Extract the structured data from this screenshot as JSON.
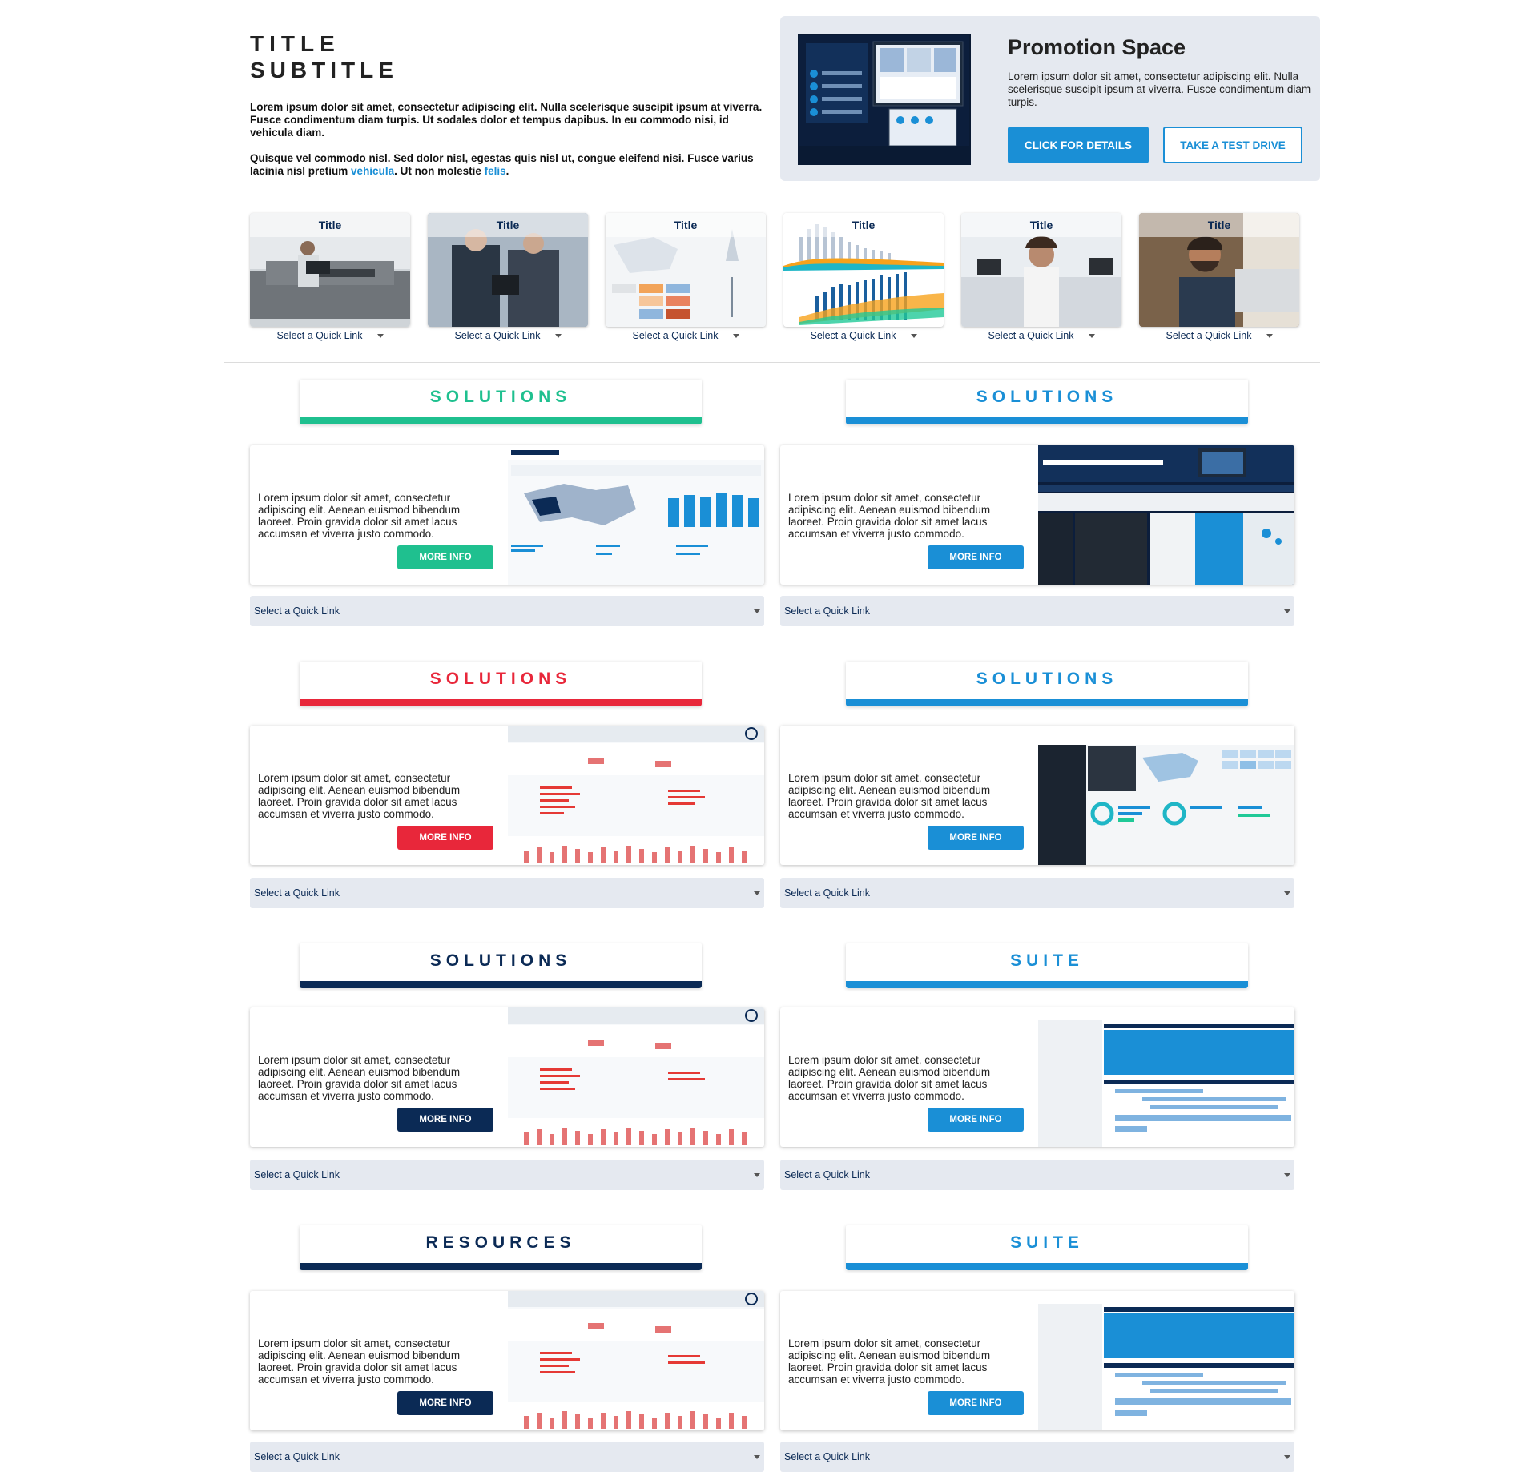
{
  "intro": {
    "title": "TITLE",
    "subtitle": "SUBTITLE",
    "para1": "Lorem ipsum dolor sit amet, consectetur adipiscing elit. Nulla scelerisque suscipit ipsum at viverra. Fusce condimentum diam turpis. Ut sodales dolor et tempus dapibus. In eu commodo nisi, id vehicula diam.",
    "para2_a": "Quisque vel commodo nisl. Sed dolor nisl, egestas quis nisl ut, congue eleifend nisi. Fusce varius lacinia nisl pretium ",
    "link1": "vehicula",
    "para2_b": ". Ut non molestie ",
    "link2": "felis",
    "para2_c": "."
  },
  "promo": {
    "title": "Promotion Space",
    "text": "Lorem ipsum dolor sit amet, consectetur adipiscing elit. Nulla scelerisque suscipit ipsum at viverra. Fusce condimentum diam turpis.",
    "primary_label": "CLICK FOR DETAILS",
    "secondary_label": "TAKE A TEST DRIVE"
  },
  "tiles": [
    {
      "title": "Title",
      "select": "Select a Quick Link"
    },
    {
      "title": "Title",
      "select": "Select a Quick Link"
    },
    {
      "title": "Title",
      "select": "Select a Quick Link"
    },
    {
      "title": "Title",
      "select": "Select a Quick Link"
    },
    {
      "title": "Title",
      "select": "Select a Quick Link"
    },
    {
      "title": "Title",
      "select": "Select a Quick Link"
    }
  ],
  "sections": [
    {
      "heading": "SOLUTIONS",
      "accent": "#1fc08f",
      "text": "Lorem ipsum dolor sit amet, consectetur adipiscing elit. Aenean euismod bibendum laoreet. Proin gravida dolor sit amet lacus accumsan et viverra justo commodo.",
      "button": "MORE INFO",
      "select": "Select a Quick Link"
    },
    {
      "heading": "SOLUTIONS",
      "accent": "#1a8fd6",
      "text": "Lorem ipsum dolor sit amet, consectetur adipiscing elit. Aenean euismod bibendum laoreet. Proin gravida dolor sit amet lacus accumsan et viverra justo commodo.",
      "button": "MORE INFO",
      "select": "Select a Quick Link"
    },
    {
      "heading": "SOLUTIONS",
      "accent": "#e8273a",
      "text": "Lorem ipsum dolor sit amet, consectetur adipiscing elit. Aenean euismod bibendum laoreet. Proin gravida dolor sit amet lacus accumsan et viverra justo commodo.",
      "button": "MORE INFO",
      "select": "Select a Quick Link"
    },
    {
      "heading": "SOLUTIONS",
      "accent": "#1a8fd6",
      "text": "Lorem ipsum dolor sit amet, consectetur adipiscing elit. Aenean euismod bibendum laoreet. Proin gravida dolor sit amet lacus accumsan et viverra justo commodo.",
      "button": "MORE INFO",
      "select": "Select a Quick Link"
    },
    {
      "heading": "SOLUTIONS",
      "accent": "#0b2a55",
      "text": "Lorem ipsum dolor sit amet, consectetur adipiscing elit. Aenean euismod bibendum laoreet. Proin gravida dolor sit amet lacus accumsan et viverra justo commodo.",
      "button": "MORE INFO",
      "select": "Select a Quick Link"
    },
    {
      "heading": "SUITE",
      "accent": "#1a8fd6",
      "text": "Lorem ipsum dolor sit amet, consectetur adipiscing elit. Aenean euismod bibendum laoreet. Proin gravida dolor sit amet lacus accumsan et viverra justo commodo.",
      "button": "MORE INFO",
      "select": "Select a Quick Link"
    },
    {
      "heading": "RESOURCES",
      "accent": "#0b2a55",
      "text": "Lorem ipsum dolor sit amet, consectetur adipiscing elit. Aenean euismod bibendum laoreet. Proin gravida dolor sit amet lacus accumsan et viverra justo commodo.",
      "button": "MORE INFO",
      "select": "Select a Quick Link"
    },
    {
      "heading": "SUITE",
      "accent": "#1a8fd6",
      "text": "Lorem ipsum dolor sit amet, consectetur adipiscing elit. Aenean euismod bibendum laoreet. Proin gravida dolor sit amet lacus accumsan et viverra justo commodo.",
      "button": "MORE INFO",
      "select": "Select a Quick Link"
    }
  ]
}
